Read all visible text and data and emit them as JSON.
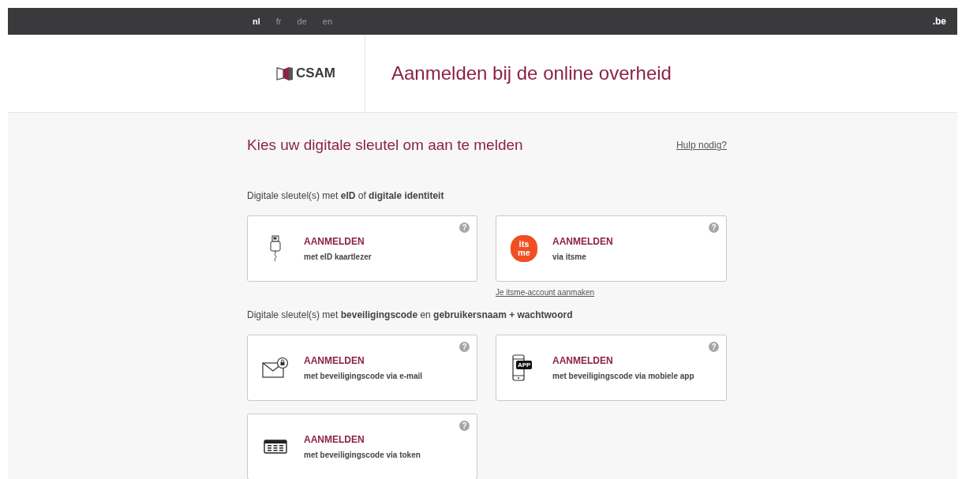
{
  "top_bar": {
    "languages": [
      {
        "label": "nl",
        "selected": true
      },
      {
        "label": "fr",
        "selected": false
      },
      {
        "label": "de",
        "selected": false
      },
      {
        "label": "en",
        "selected": false
      }
    ],
    "domain": ".be"
  },
  "header": {
    "logo_text": "CSAM",
    "title": "Aanmelden bij de online overheid"
  },
  "main": {
    "heading": "Kies uw digitale sleutel om aan te melden",
    "help_link": "Hulp nodig?",
    "sections": [
      {
        "label": "Digitale sleutel(s) met **eID** of **digitale identiteit**",
        "cards": [
          {
            "icon": {
              "kind": "card-reader"
            },
            "title": "AANMELDEN",
            "subtitle": "met eID kaartlezer",
            "help": "?"
          },
          {
            "icon": {
              "kind": "itsme",
              "text": [
                "its",
                "me"
              ]
            },
            "title": "AANMELDEN",
            "subtitle": "via itsme",
            "help": "?",
            "link": "Je itsme-account aanmaken"
          }
        ]
      },
      {
        "label": "Digitale sleutel(s) met **beveiligingscode** en **gebruikersnaam + wachtwoord**",
        "cards": [
          {
            "icon": {
              "kind": "mail"
            },
            "title": "AANMELDEN",
            "subtitle": "met beveiligingscode via e-mail",
            "help": "?"
          },
          {
            "icon": {
              "kind": "phone",
              "text": [
                "APP"
              ]
            },
            "title": "AANMELDEN",
            "subtitle": "met beveiligingscode via mobiele app",
            "help": "?"
          },
          {
            "icon": {
              "kind": "token"
            },
            "title": "AANMELDEN",
            "subtitle": "met beveiligingscode via token",
            "help": "?"
          }
        ]
      }
    ]
  }
}
